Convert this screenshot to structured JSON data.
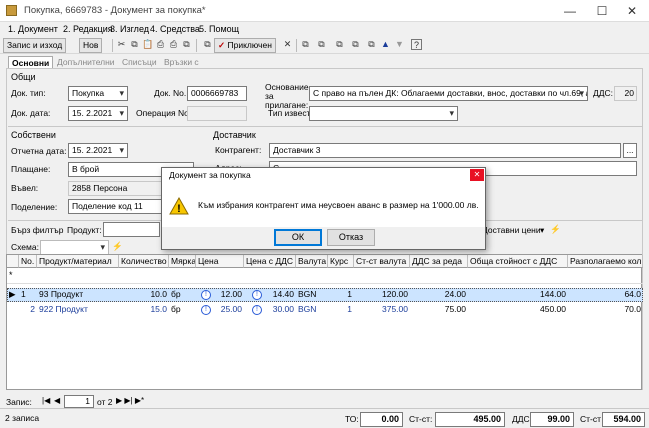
{
  "window": {
    "title": "Покупка, 6669783 - Документ за покупка*",
    "minimize": "—",
    "maximize": "☐",
    "close": "✕"
  },
  "menu": [
    "1. Документ",
    "2. Редакция",
    "3. Изглед",
    "4. Средства",
    "5. Помощ"
  ],
  "toolbar": {
    "save_exit": "Запис и изход",
    "new": "Нов",
    "apply": "Приключен",
    "print_icon": "⎙",
    "cut_icon": "✂",
    "copy_icon": "⧉",
    "paste_icon": "📋",
    "check_icon": "✓",
    "close_icon": "✕",
    "up_icon": "▲",
    "down_icon": "▼",
    "help_icon": "?"
  },
  "tabs": [
    "Основни",
    "Допълнителни",
    "Списъци",
    "Връзки с документи"
  ],
  "general": {
    "title": "Общи",
    "doc_type_label": "Док. тип:",
    "doc_type": "Покупка",
    "doc_no_label": "Док. No.",
    "doc_no": "0006669783",
    "doc_date_label": "Док. дата:",
    "doc_date": "15.  2.2021",
    "op_no_label": "Операция No.",
    "op_no": "",
    "basis_label": "Основание за прилагане:",
    "basis": "С право на пълен ДК: Облагаеми доставки, внос, доставки по чл.69, ал.2",
    "vat_label": "ДДС:",
    "vat": "20",
    "notice_label": "Тип известие:",
    "notice": ""
  },
  "own": {
    "title": "Собствени",
    "report_date_label": "Отчетна дата:",
    "report_date": "15.  2.2021",
    "payment_label": "Плащане:",
    "payment": "В брой",
    "entered_label": "Въвел:",
    "entered": "2858 Персона",
    "division_label": "Поделение:",
    "division": "Поделение код 11"
  },
  "supplier": {
    "title": "Доставчик",
    "contragent_label": "Контрагент:",
    "contragent": "Доставчик 3",
    "address_label": "Адрес:",
    "address": "С..."
  },
  "filter": {
    "quick_label": "Бърз филтър",
    "product_label": "Продукт:",
    "scheme_label": "Схема:",
    "supplied_label": "Доставни цени"
  },
  "grid": {
    "headers": [
      "No.",
      "Продукт/материал",
      "Количество",
      "Мярка",
      "Цена",
      "Цена с ДДС",
      "Валута",
      "Курс",
      "Ст-ст валута",
      "ДДС за реда",
      "Обща стойност с ДДС",
      "Разполагаемо кол."
    ],
    "rows": [
      {
        "no": "1",
        "product": "93 Продукт",
        "qty": "10.0",
        "unit": "бр",
        "price": "12.00",
        "price_vat": "14.40",
        "currency": "BGN",
        "rate": "1",
        "value": "120.00",
        "vat": "24.00",
        "total": "144.00",
        "available": "64.0"
      },
      {
        "no": "2",
        "product": "922 Продукт",
        "qty": "15.0",
        "unit": "бр",
        "price": "25.00",
        "price_vat": "30.00",
        "currency": "BGN",
        "rate": "1",
        "value": "375.00",
        "vat": "75.00",
        "total": "450.00",
        "available": "70.0"
      }
    ]
  },
  "nav": {
    "record_label": "Запис:",
    "current": "1",
    "of_label": "от 2"
  },
  "status": {
    "records": "2 записа",
    "to_label": "ТО:",
    "to": "0.00",
    "cost_label": "Ст-ст:",
    "cost": "495.00",
    "vat_label": "ДДС:",
    "vat": "99.00",
    "cost_vat_label": "Ст-ст с ДДС:",
    "cost_vat": "594.00"
  },
  "dialog": {
    "title": "Документ за покупка",
    "message": "Към избрания контрагент има неусвоен аванс в размер на 1'000.00 лв.",
    "ok": "ОК",
    "cancel": "Отказ",
    "close": "✕",
    "warning_glyph": "!"
  }
}
